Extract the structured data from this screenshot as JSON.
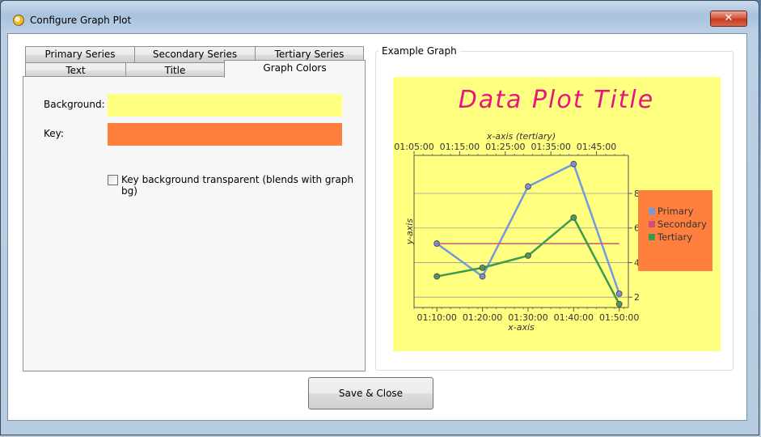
{
  "window": {
    "title": "Configure Graph Plot",
    "close_glyph": "✕"
  },
  "tabs_row1": [
    "Primary Series",
    "Secondary Series",
    "Tertiary Series"
  ],
  "tabs_row2": [
    "Text",
    "Title",
    "Graph Colors"
  ],
  "active_tab": "Graph Colors",
  "graph_colors": {
    "background_label": "Background:",
    "background_color": "#ffff80",
    "key_label": "Key:",
    "key_color": "#ff7f3f",
    "key_transparent_label": "Key background transparent (blends with graph bg)",
    "key_transparent_checked": false
  },
  "example_graph": {
    "legend": "Example Graph"
  },
  "save_button": "Save & Close",
  "chart_data": {
    "type": "line",
    "title": "Data Plot Title",
    "title_color": "#e8157d",
    "xlabel": "x-axis",
    "x2label": "x-axis (tertiary)",
    "ylabel": "y-axis",
    "x_ticks": [
      "01:10:00",
      "01:20:00",
      "01:30:00",
      "01:40:00",
      "01:50:00"
    ],
    "x2_ticks": [
      "01:05:00",
      "01:15:00",
      "01:25:00",
      "01:35:00",
      "01:45:00"
    ],
    "y_ticks": [
      2,
      4,
      6,
      8
    ],
    "ylim": [
      1.4,
      10.2
    ],
    "xlim": [
      "01:05:00",
      "01:52:00"
    ],
    "grid": true,
    "legend_position": "right",
    "series": [
      {
        "name": "Primary",
        "color": "#6f9ae0",
        "points": [
          [
            "01:10:00",
            5.1
          ],
          [
            "01:20:00",
            3.2
          ],
          [
            "01:30:00",
            8.4
          ],
          [
            "01:40:00",
            9.7
          ],
          [
            "01:50:00",
            2.2
          ]
        ]
      },
      {
        "name": "Secondary",
        "color": "#d0507a",
        "points": [
          [
            "01:10:00",
            5.1
          ],
          [
            "01:50:00",
            5.1
          ]
        ]
      },
      {
        "name": "Tertiary",
        "color": "#3c9a50",
        "points": [
          [
            "01:10:00",
            3.2
          ],
          [
            "01:20:00",
            3.7
          ],
          [
            "01:30:00",
            4.4
          ],
          [
            "01:40:00",
            6.6
          ],
          [
            "01:50:00",
            1.6
          ]
        ]
      }
    ]
  }
}
